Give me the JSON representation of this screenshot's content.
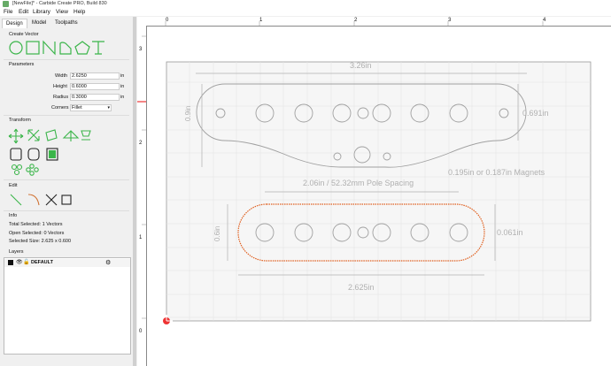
{
  "window": {
    "title": "[NewFile]* - Carbide Create PRO, Build 830"
  },
  "menu": [
    "File",
    "Edit",
    "Library",
    "View",
    "Help"
  ],
  "tabs": [
    "Design",
    "Model",
    "Toolpaths"
  ],
  "create_vector": {
    "title": "Create Vector"
  },
  "parameters": {
    "title": "Parameters",
    "width_label": "Width",
    "width_value": "2.6250",
    "width_unit": "in",
    "height_label": "Height",
    "height_value": "0.6000",
    "height_unit": "in",
    "radius_label": "Radius",
    "radius_value": "0.3000",
    "radius_unit": "in",
    "corners_label": "Corners",
    "corners_value": "Fillet"
  },
  "transform": {
    "title": "Transform"
  },
  "edit": {
    "title": "Edit"
  },
  "info": {
    "title": "Info",
    "total_selected": "Total Selected:  1 Vectors",
    "open_selected": "Open Selected:  0 Vectors",
    "selected_size": "Selected Size:   2.625 x 0.600"
  },
  "layers": {
    "title": "Layers",
    "items": [
      {
        "name": "DEFAULT",
        "color": "#111111"
      }
    ]
  },
  "ruler": {
    "top_ticks": [
      "0",
      "1",
      "2",
      "3",
      "4"
    ],
    "left_ticks": [
      "3",
      "2",
      "1",
      "0"
    ]
  },
  "drawing": {
    "dim_width_top": "3.26in",
    "dim_height_left": "0.9in",
    "dim_right_top": "0.691in",
    "magnets_note": "0.195in or 0.187in Magnets",
    "pole_spacing": "2.06in / 52.32mm Pole Spacing",
    "dim_height_bottom": "0.6in",
    "dim_right_bottom": "0.061in",
    "dim_width_bottom": "2.625in"
  },
  "colors": {
    "accent_green": "#3bb54a",
    "selection": "#e06020",
    "shape": "#a0a0a0",
    "dim": "#b0b0b0"
  }
}
